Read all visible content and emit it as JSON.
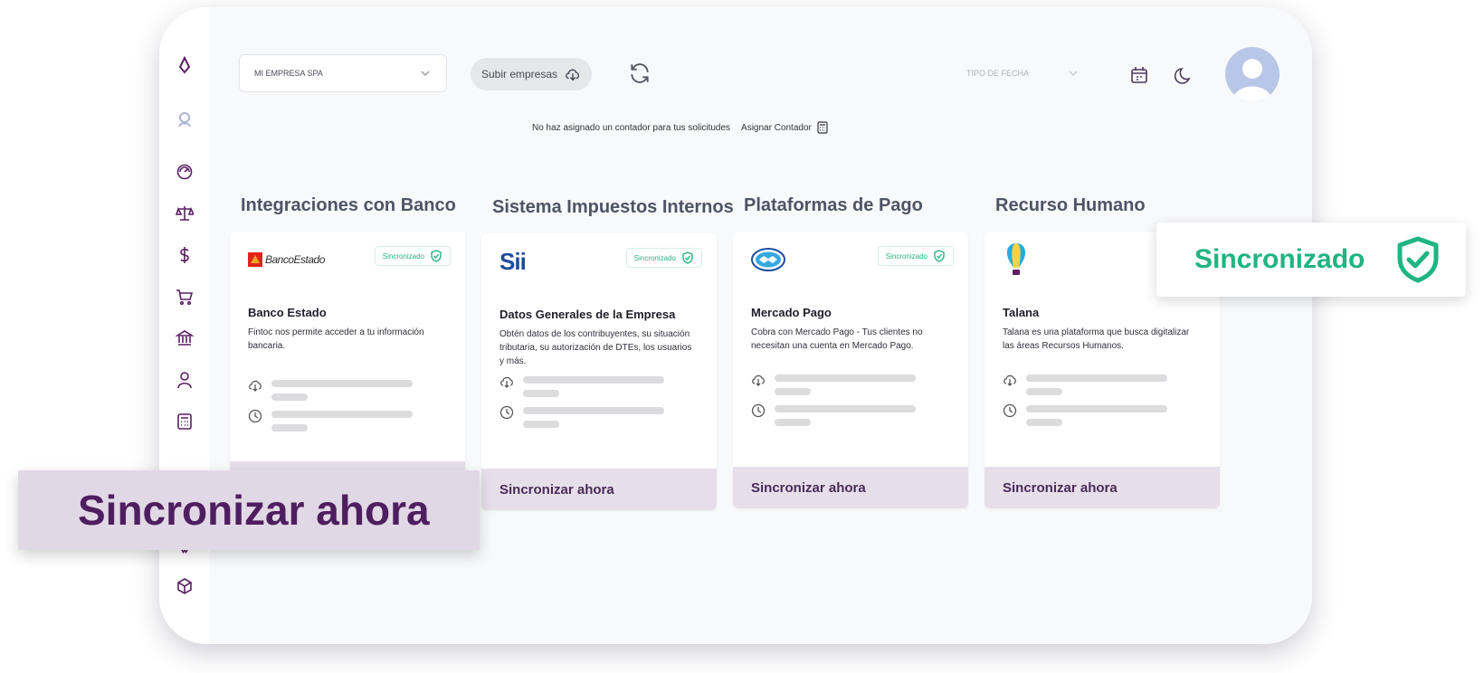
{
  "toolbar": {
    "company_select": "MI EMPRESA SPA",
    "upload_label": "Subir empresas",
    "date_type": "TIPO DE FECHA"
  },
  "notice": {
    "text": "No haz asignado un contador para tus solicitudes",
    "assign_label": "Asignar Contador"
  },
  "sections": [
    {
      "title": "Integraciones con Banco",
      "logo_text": "BancoEstado",
      "badge": "Sincronizado",
      "name": "Banco Estado",
      "description": "Fintoc nos permite acceder a tu información bancaria.",
      "sync_label": "Sincronizar ahora"
    },
    {
      "title": "Sistema Impuestos Internos",
      "logo_text": "Sii",
      "badge": "Sincronizado",
      "name": "Datos Generales de la Empresa",
      "description": "Obtén datos de los contribuyentes, su situación tributaria, su autorización de DTEs, los usuarios y más.",
      "sync_label": "Sincronizar ahora"
    },
    {
      "title": "Plataformas de Pago",
      "badge": "Sincronizado",
      "name": "Mercado Pago",
      "description": "Cobra con Mercado Pago - Tus clientes no necesitan una cuenta en Mercado  Pago.",
      "sync_label": "Sincronizar ahora"
    },
    {
      "title": "Recurso Humano",
      "name": "Talana",
      "description": "Talana es una plataforma que busca digitalizar las áreas Recursos Humanos.",
      "sync_label": "Sincronizar ahora"
    }
  ],
  "overlays": {
    "sync_now": "Sincronizar ahora",
    "synced": "Sincronizado"
  },
  "colors": {
    "brand": "#5a1f63",
    "success": "#1fb580",
    "sync_bg": "#e6dfea"
  }
}
